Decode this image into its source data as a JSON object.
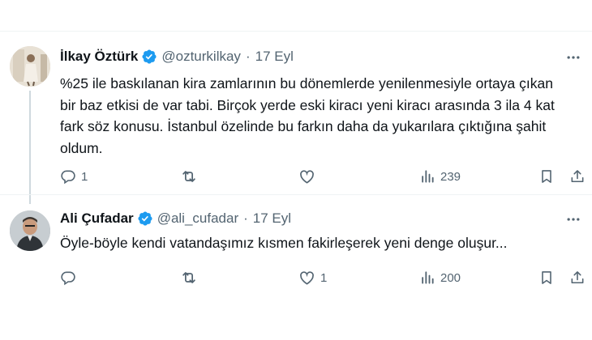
{
  "tweets": [
    {
      "name": "İlkay Öztürk",
      "handle": "@ozturkilkay",
      "separator": "·",
      "date": "17 Eyl",
      "text": "%25 ile baskılanan kira zamlarının bu dönemlerde yenilenmesiyle ortaya çıkan bir baz etkisi de var tabi. Birçok yerde eski kiracı yeni kiracı arasında 3 ila 4 kat fark söz konusu. İstanbul özelinde bu farkın daha da yukarılara çıktığına şahit oldum.",
      "replies": "1",
      "retweets": "",
      "likes": "",
      "views": "239"
    },
    {
      "name": "Ali Çufadar",
      "handle": "@ali_cufadar",
      "separator": "·",
      "date": "17 Eyl",
      "text": "Öyle-böyle kendi vatandaşımız kısmen fakirleşerek yeni denge oluşur...",
      "replies": "",
      "retweets": "",
      "likes": "1",
      "views": "200"
    }
  ],
  "colors": {
    "verified": "#1d9bf0",
    "text": "#0f1419",
    "secondary": "#536471",
    "divider": "#eff3f4",
    "thread_line": "#cfd9de"
  },
  "icons": [
    "verified-badge-icon",
    "more-icon",
    "reply-icon",
    "retweet-icon",
    "like-icon",
    "views-icon",
    "bookmark-icon",
    "share-icon"
  ]
}
